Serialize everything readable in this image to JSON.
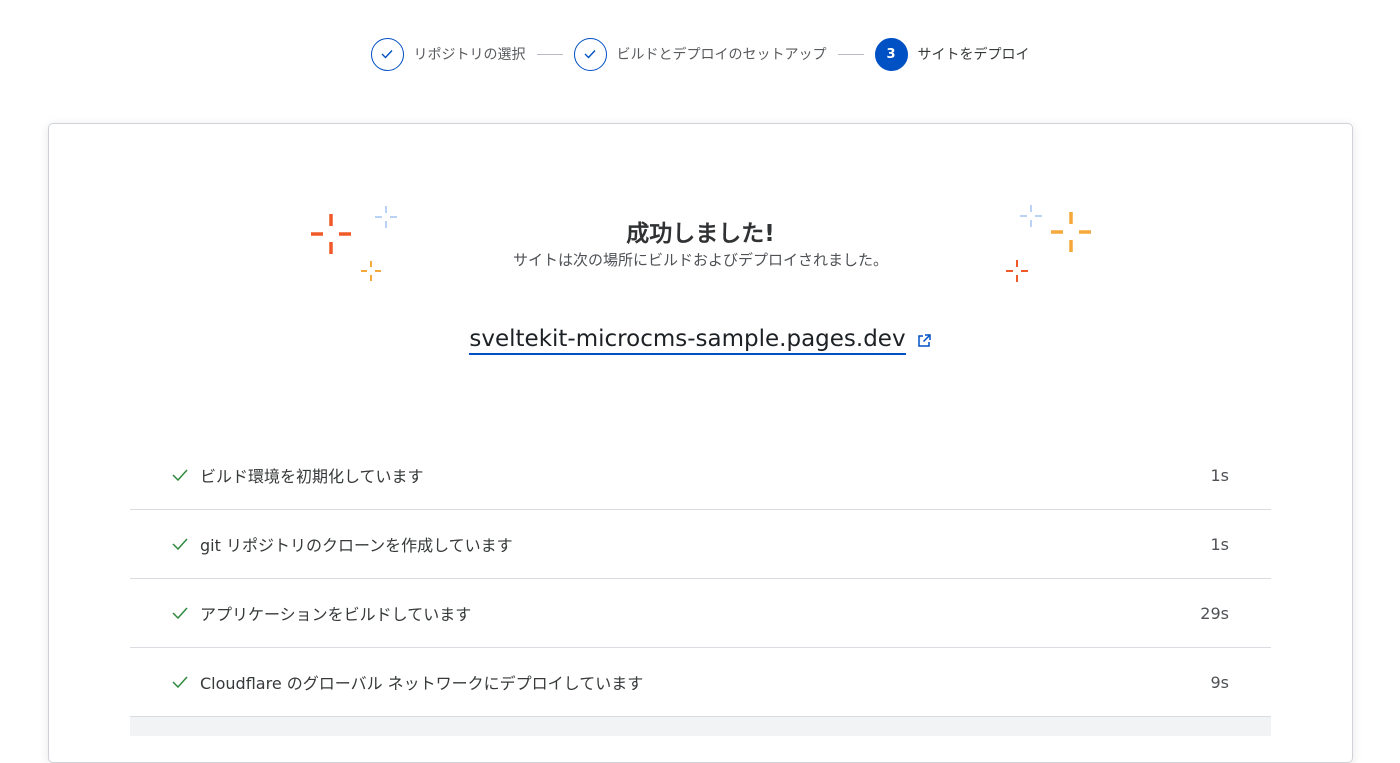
{
  "stepper": {
    "steps": [
      {
        "label": "リポジトリの選択",
        "state": "done"
      },
      {
        "label": "ビルドとデプロイのセットアップ",
        "state": "done"
      },
      {
        "label": "サイトをデプロイ",
        "state": "active",
        "number": "3"
      }
    ]
  },
  "result": {
    "title": "成功しました!",
    "subtitle": "サイトは次の場所にビルドおよびデプロイされました。",
    "url": "sveltekit-microcms-sample.pages.dev",
    "external_icon": "external-link-icon"
  },
  "logs": [
    {
      "text": "ビルド環境を初期化しています",
      "time": "1s"
    },
    {
      "text": "git リポジトリのクローンを作成しています",
      "time": "1s"
    },
    {
      "text": "アプリケーションをビルドしています",
      "time": "29s"
    },
    {
      "text": "Cloudflare のグローバル ネットワークにデプロイしています",
      "time": "9s"
    }
  ],
  "colors": {
    "accent": "#0051c3",
    "success": "#2f8a3f",
    "sparkle_orange": "#f05a28",
    "sparkle_yellow": "#f4a93a",
    "sparkle_blue": "#b9d2f6"
  }
}
